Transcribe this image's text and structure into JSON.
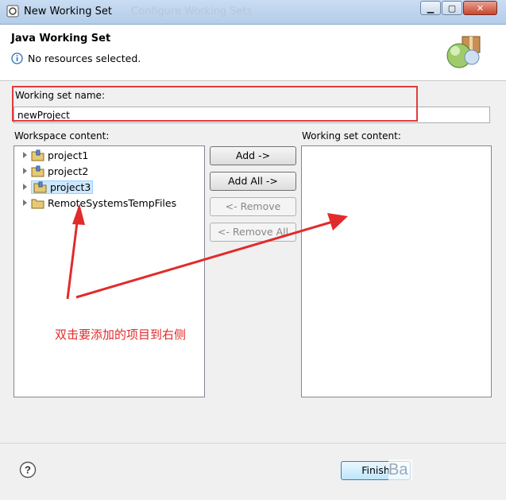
{
  "window": {
    "title": "New Working Set",
    "ghost_title": "Configure Working Sets"
  },
  "header": {
    "title": "Java Working Set",
    "message": "No resources selected."
  },
  "name_field": {
    "label": "Working set name:",
    "value": "newProject"
  },
  "workspace": {
    "label": "Workspace content:",
    "items": [
      {
        "label": "project1",
        "kind": "project"
      },
      {
        "label": "project2",
        "kind": "project"
      },
      {
        "label": "project3",
        "kind": "project",
        "selected": true
      },
      {
        "label": "RemoteSystemsTempFiles",
        "kind": "folder"
      }
    ]
  },
  "working_set": {
    "label": "Working set content:"
  },
  "buttons": {
    "add": "Add ->",
    "add_all": "Add All ->",
    "remove": "<- Remove",
    "remove_all": "<- Remove All",
    "finish": "Finish"
  },
  "annotation": {
    "text": "双击要添加的项目到右侧"
  },
  "watermark": "Ba",
  "colors": {
    "annotation": "#e12b2b",
    "titlebar": "#c9ddf2",
    "selection": "#cce8ff"
  }
}
